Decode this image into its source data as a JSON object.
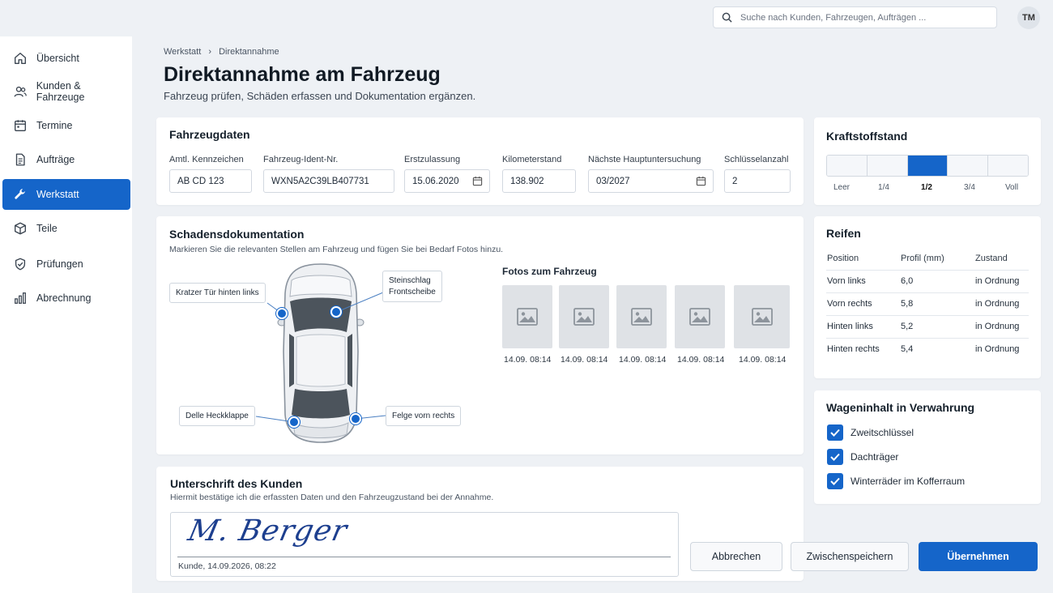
{
  "search": {
    "placeholder": "Suche nach Kunden, Fahrzeugen, Aufträgen ..."
  },
  "user": {
    "initials": "TM"
  },
  "sidebar": {
    "items": [
      {
        "label": "Übersicht",
        "icon": "home-icon"
      },
      {
        "label": "Kunden & Fahrzeuge",
        "icon": "users-icon"
      },
      {
        "label": "Termine",
        "icon": "calendar-icon"
      },
      {
        "label": "Aufträge",
        "icon": "document-icon"
      },
      {
        "label": "Werkstatt",
        "icon": "wrench-icon",
        "active": true
      },
      {
        "label": "Teile",
        "icon": "box-icon"
      },
      {
        "label": "Prüfungen",
        "icon": "shield-check-icon"
      },
      {
        "label": "Abrechnung",
        "icon": "bar-chart-icon"
      }
    ]
  },
  "breadcrumb": {
    "root": "Werkstatt",
    "separator": "›",
    "current": "Direktannahme"
  },
  "page": {
    "title": "Direktannahme am Fahrzeug",
    "subtitle": "Fahrzeug prüfen, Schäden erfassen und Dokumentation ergänzen."
  },
  "vehicle": {
    "title": "Fahrzeugdaten",
    "fields": {
      "plate": {
        "label": "Amtl. Kennzeichen",
        "value": "AB CD 123"
      },
      "vin": {
        "label": "Fahrzeug-Ident-Nr.",
        "value": "WXN5A2C39LB407731"
      },
      "registration": {
        "label": "Erstzulassung",
        "value": "15.06.2020"
      },
      "mileage": {
        "label": "Kilometerstand",
        "value": "138.902"
      },
      "inspection": {
        "label": "Nächste Hauptuntersuchung",
        "value": "03/2027"
      },
      "keys": {
        "label": "Schlüsselanzahl",
        "value": "2"
      }
    }
  },
  "fuel": {
    "title": "Kraftstoffstand",
    "levels": [
      "Leer",
      "1/4",
      "1/2",
      "3/4",
      "Voll"
    ],
    "selected_index": 2
  },
  "damage": {
    "title": "Schadensdokumentation",
    "hint": "Markieren Sie die relevanten Stellen am Fahrzeug und fügen Sie bei Bedarf Fotos hinzu.",
    "markers": [
      {
        "label": "Kratzer Tür hinten links"
      },
      {
        "label_line1": "Steinschlag",
        "label_line2": "Frontscheibe"
      },
      {
        "label": "Delle Heckklappe"
      },
      {
        "label": "Felge vorn rechts"
      }
    ],
    "photos_title": "Fotos zum Fahrzeug",
    "photos": [
      {
        "timestamp": "14.09. 08:14"
      },
      {
        "timestamp": "14.09. 08:14"
      },
      {
        "timestamp": "14.09. 08:14"
      },
      {
        "timestamp": "14.09. 08:14"
      },
      {
        "timestamp": "14.09. 08:14"
      }
    ]
  },
  "tires": {
    "title": "Reifen",
    "columns": [
      "Position",
      "Profil (mm)",
      "Zustand"
    ],
    "rows": [
      [
        "Vorn links",
        "6,0",
        "in Ordnung"
      ],
      [
        "Vorn rechts",
        "5,8",
        "in Ordnung"
      ],
      [
        "Hinten links",
        "5,2",
        "in Ordnung"
      ],
      [
        "Hinten rechts",
        "5,4",
        "in Ordnung"
      ]
    ]
  },
  "contents": {
    "title": "Wageninhalt in Verwahrung",
    "items": [
      {
        "label": "Zweitschlüssel",
        "checked": true
      },
      {
        "label": "Dachträger",
        "checked": true
      },
      {
        "label": "Winterräder im Kofferraum",
        "checked": true
      }
    ]
  },
  "signature": {
    "title": "Unterschrift des Kunden",
    "hint": "Hiermit bestätige ich die erfassten Daten und den Fahrzeugzustand bei der Annahme.",
    "signature_text": "M. Berger",
    "caption": "Kunde, 14.09.2026, 08:22"
  },
  "actions": {
    "cancel": "Abbrechen",
    "save_draft": "Zwischenspeichern",
    "submit": "Übernehmen"
  },
  "colors": {
    "accent": "#1565c9",
    "background": "#eef1f5",
    "card": "#ffffff"
  }
}
